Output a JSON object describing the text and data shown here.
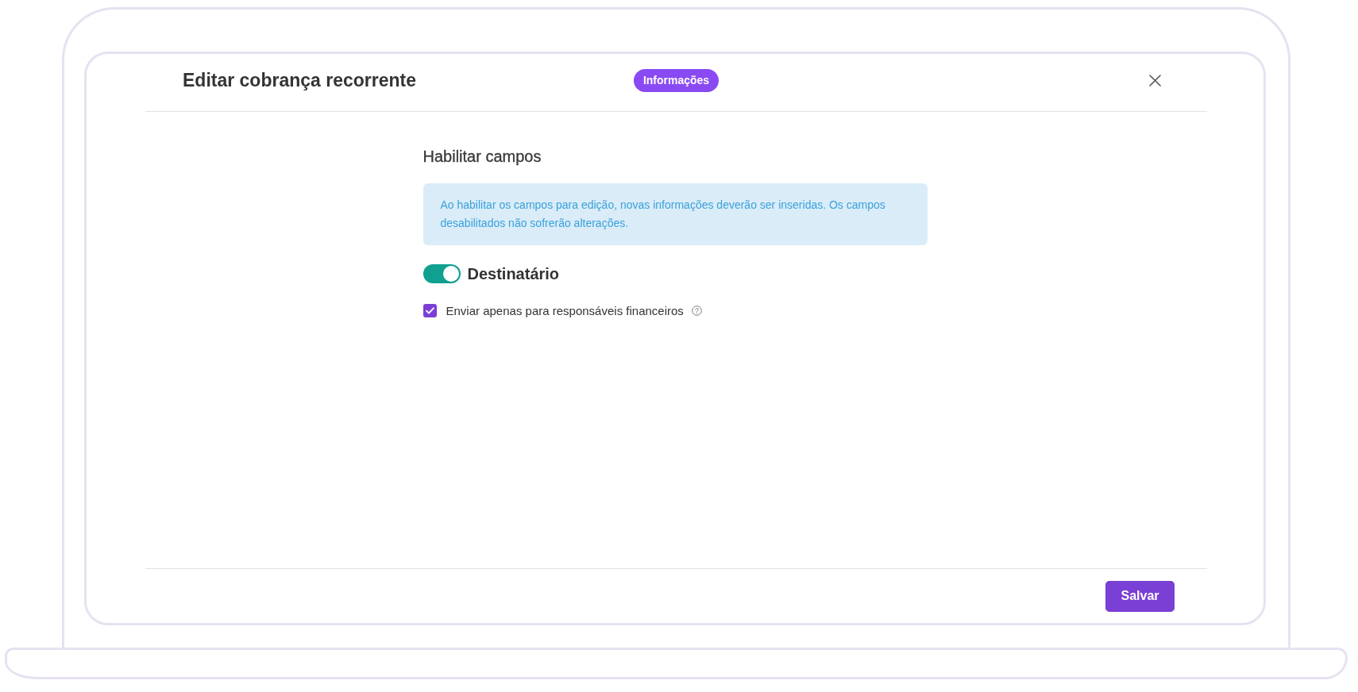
{
  "dialog": {
    "title": "Editar cobrança recorrente",
    "badge": "Informações",
    "footer_button": "Salvar"
  },
  "section": {
    "heading": "Habilitar campos",
    "notice": "Ao habilitar os campos para edição, novas informações deverão ser inseridas. Os campos desabilitados não sofrerão alterações.",
    "toggle": {
      "label": "Destinatário",
      "on": true
    },
    "checkbox": {
      "label": "Enviar apenas para responsáveis financeiros",
      "checked": true
    }
  }
}
